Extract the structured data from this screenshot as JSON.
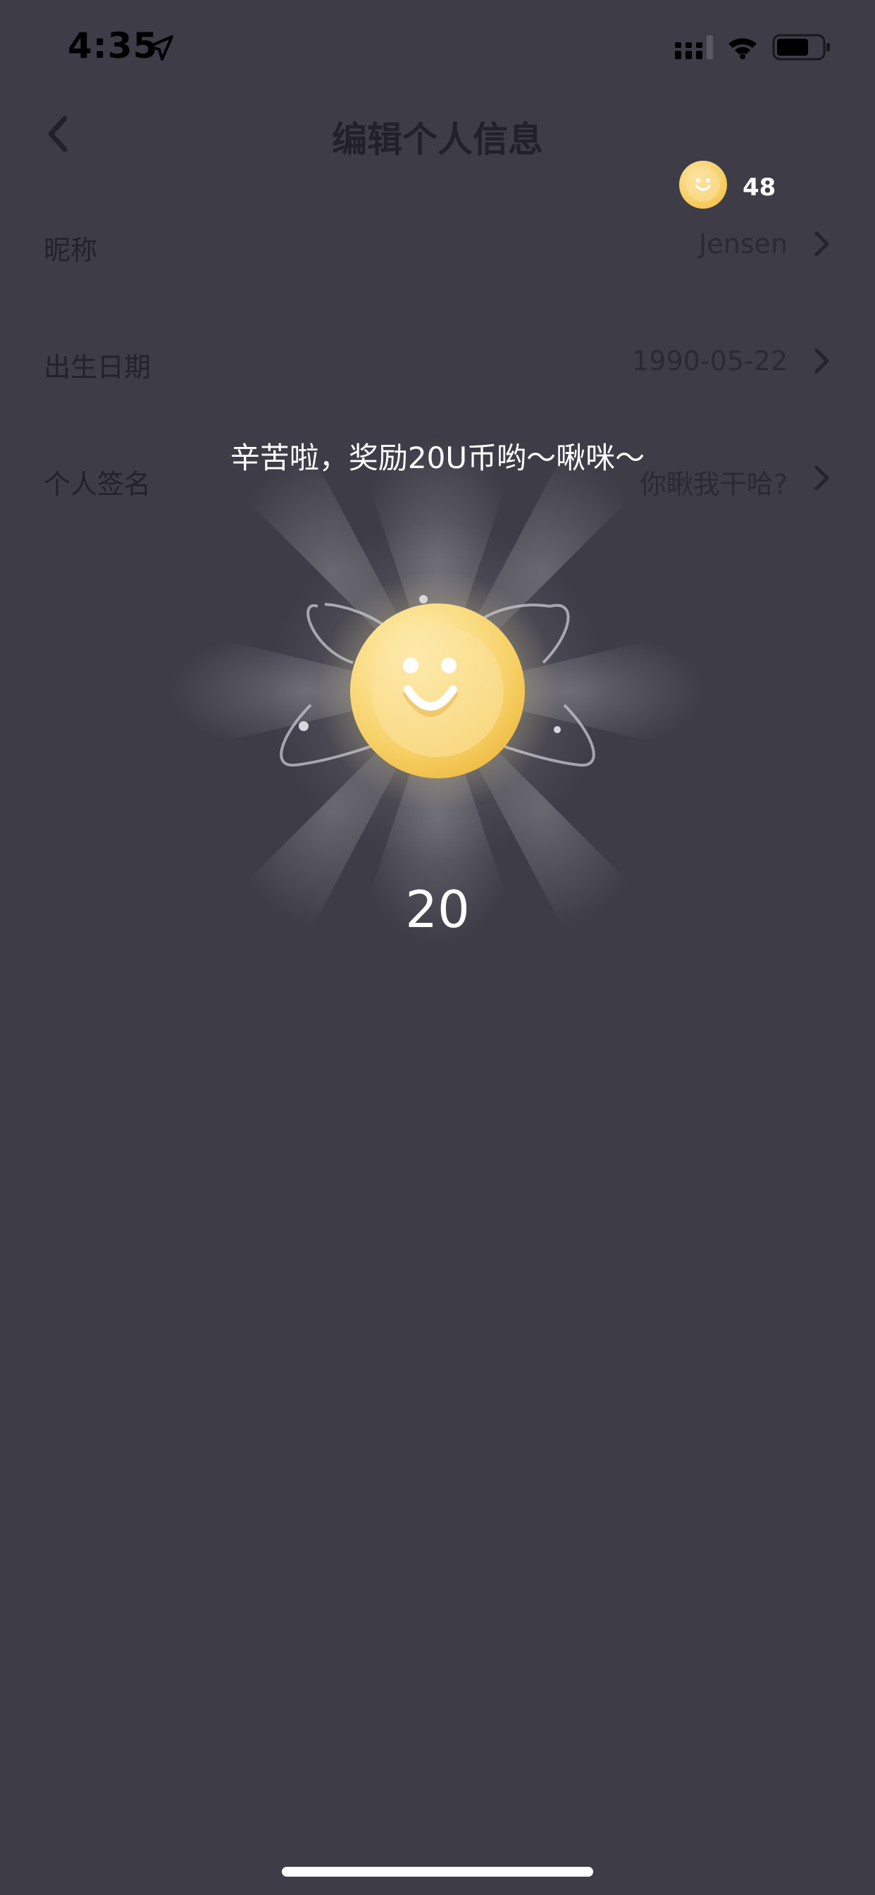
{
  "status_bar": {
    "time": "4:35"
  },
  "nav": {
    "title": "编辑个人信息"
  },
  "rows": [
    {
      "label": "昵称",
      "value": "Jensen"
    },
    {
      "label": "出生日期",
      "value": "1990-05-22"
    },
    {
      "label": "个人签名",
      "value": "你瞅我干哈?"
    }
  ],
  "balance": {
    "value": "48"
  },
  "reward": {
    "message": "辛苦啦，奖励20U币哟～啾咪～",
    "amount": "20"
  },
  "colors": {
    "background": "#3d3c47",
    "coin_gold": "#f6cf5a",
    "coin_light": "#fbe3a0"
  }
}
